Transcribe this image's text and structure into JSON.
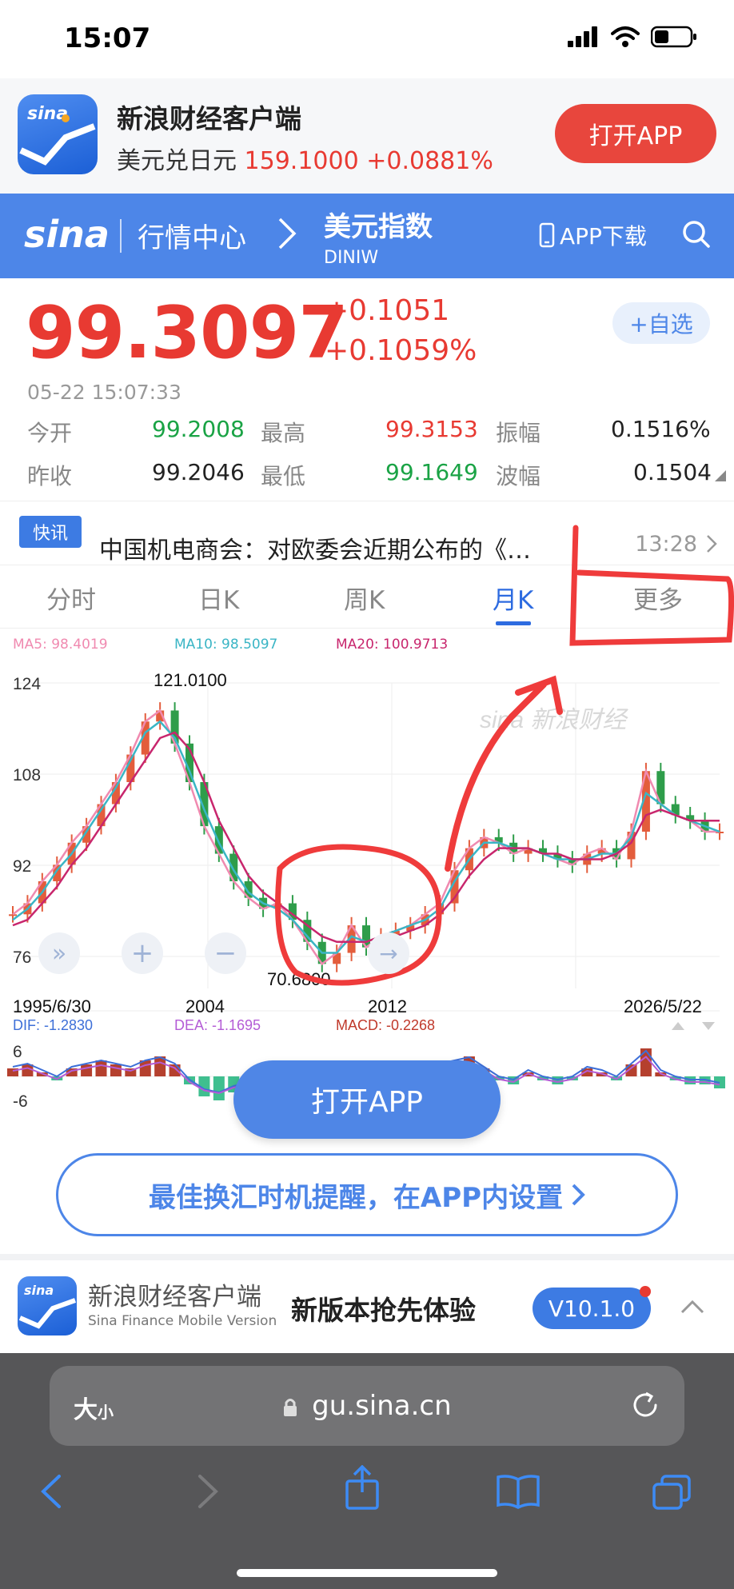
{
  "status_bar": {
    "time": "15:07"
  },
  "promo": {
    "title": "新浪财经客户端",
    "pair_label": "美元兑日元",
    "pair_price": "159.1000",
    "pair_change": "+0.0881%",
    "open_button": "打开APP"
  },
  "nav": {
    "logo": "sina",
    "market": "行情中心",
    "name": "美元指数",
    "code": "DINIW",
    "download": "APP下载"
  },
  "quote": {
    "price": "99.3097",
    "change_abs": "+0.1051",
    "change_pct": "+0.1059%",
    "watch_button": "+自选",
    "timestamp": "05-22   15:07:33",
    "stats": {
      "open_label": "今开",
      "open": "99.2008",
      "high_label": "最高",
      "high": "99.3153",
      "amp_label": "振幅",
      "amp": "0.1516%",
      "prev_label": "昨收",
      "prev": "99.2046",
      "low_label": "最低",
      "low": "99.1649",
      "wave_label": "波幅",
      "wave": "0.1504"
    }
  },
  "news": {
    "badge": "快讯",
    "text": "中国机电商会：对欧委会近期公布的《…",
    "time": "13:28"
  },
  "tabs": [
    {
      "label": "分时"
    },
    {
      "label": "日K"
    },
    {
      "label": "周K"
    },
    {
      "label": "月K",
      "active": true
    },
    {
      "label": "更多"
    }
  ],
  "chart_legend": {
    "ma5": "MA5: 98.4019",
    "ma10": "MA10: 98.5097",
    "ma20": "MA20: 100.9713",
    "dif": "DIF: -1.2830",
    "dea": "DEA: -1.1695",
    "macd": "MACD: -0.2268"
  },
  "chart_data": {
    "type": "line",
    "y_ticks": [
      "124",
      "108",
      "92",
      "76"
    ],
    "x_ticks": [
      "1995/6/30",
      "2004",
      "2012",
      "2026/5/22"
    ],
    "high_label": "121.0100",
    "low_label": "70.6800",
    "ylim": [
      72,
      126
    ],
    "macd_ticks": [
      "6",
      "-6"
    ],
    "series": [
      {
        "name": "MA5",
        "color": "#f08ab0",
        "values": [
          84,
          86,
          90,
          93,
          97,
          100,
          104,
          108,
          113,
          119,
          121,
          115,
          108,
          100,
          95,
          90,
          87,
          85,
          86,
          83,
          79,
          75,
          77,
          82,
          78,
          80,
          81,
          82,
          84,
          86,
          92,
          96,
          98,
          97,
          95,
          96,
          95,
          94,
          93,
          95,
          96,
          94,
          99,
          110,
          104,
          102,
          101,
          99,
          99
        ]
      },
      {
        "name": "MA10",
        "color": "#3ab5c5",
        "values": [
          83,
          85,
          88,
          92,
          95,
          99,
          103,
          107,
          112,
          117,
          119,
          116,
          110,
          103,
          97,
          92,
          88,
          86,
          85,
          83,
          80,
          77,
          77,
          80,
          79,
          80,
          81,
          82,
          83,
          85,
          90,
          94,
          97,
          97,
          96,
          96,
          95,
          94,
          94,
          94,
          95,
          95,
          98,
          106,
          104,
          102,
          101,
          100,
          99
        ]
      },
      {
        "name": "MA20",
        "color": "#c8266d",
        "values": [
          82,
          83,
          86,
          89,
          93,
          96,
          100,
          104,
          108,
          112,
          116,
          117,
          114,
          108,
          101,
          96,
          91,
          88,
          86,
          84,
          82,
          80,
          79,
          79,
          79,
          80,
          80,
          81,
          82,
          84,
          87,
          91,
          94,
          96,
          96,
          96,
          95,
          95,
          94,
          94,
          94,
          95,
          97,
          102,
          103,
          102,
          101,
          101,
          101
        ]
      }
    ],
    "macd_values": [
      2,
      3,
      1,
      -1,
      2,
      3,
      4,
      3,
      2,
      4,
      5,
      3,
      -2,
      -5,
      -6,
      -4,
      -3,
      -1,
      1,
      -2,
      -4,
      -5,
      -2,
      1,
      -1,
      0,
      1,
      2,
      1,
      3,
      4,
      5,
      2,
      -1,
      -2,
      1,
      -1,
      -2,
      -1,
      2,
      1,
      -1,
      3,
      7,
      1,
      -1,
      -2,
      -2,
      -3
    ]
  },
  "float_button": "打开APP",
  "reminder": "最佳换汇时机提醒，在APP内设置",
  "bottom_banner": {
    "name": "新浪财经客户端",
    "sub": "Sina Finance Mobile Version",
    "slogan": "新版本抢先体验",
    "version": "V10.1.0"
  },
  "browser": {
    "text_size": "大",
    "text_size_small": "小",
    "url": "gu.sina.cn"
  },
  "colors": {
    "brand_blue": "#4d86e8",
    "up_red": "#e83a32",
    "down_green": "#1aa345"
  }
}
